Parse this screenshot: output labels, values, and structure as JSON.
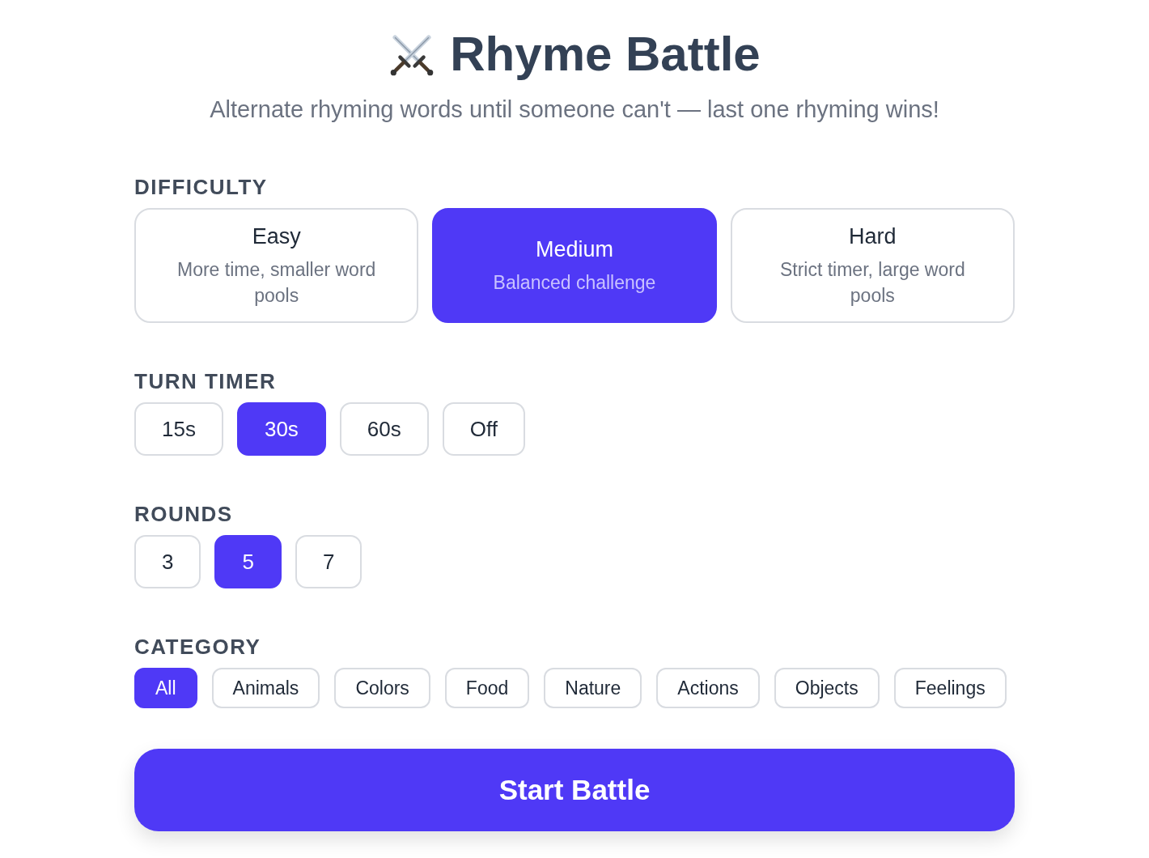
{
  "header": {
    "title": "Rhyme Battle",
    "subtitle": "Alternate rhyming words until someone can't — last one rhyming wins!"
  },
  "sections": [
    {
      "kind": "cards",
      "label": "DIFFICULTY",
      "options": [
        {
          "title": "Easy",
          "description": "More time, smaller word pools",
          "selected": false
        },
        {
          "title": "Medium",
          "description": "Balanced challenge",
          "selected": true
        },
        {
          "title": "Hard",
          "description": "Strict timer, large word pools",
          "selected": false
        }
      ]
    },
    {
      "kind": "buttons",
      "label": "TURN TIMER",
      "options": [
        {
          "label": "15s",
          "selected": false
        },
        {
          "label": "30s",
          "selected": true
        },
        {
          "label": "60s",
          "selected": false
        },
        {
          "label": "Off",
          "selected": false
        }
      ]
    },
    {
      "kind": "buttons",
      "label": "ROUNDS",
      "options": [
        {
          "label": "3",
          "selected": false
        },
        {
          "label": "5",
          "selected": true
        },
        {
          "label": "7",
          "selected": false
        }
      ]
    },
    {
      "kind": "chips",
      "label": "CATEGORY",
      "options": [
        {
          "label": "All",
          "selected": true
        },
        {
          "label": "Animals",
          "selected": false
        },
        {
          "label": "Colors",
          "selected": false
        },
        {
          "label": "Food",
          "selected": false
        },
        {
          "label": "Nature",
          "selected": false
        },
        {
          "label": "Actions",
          "selected": false
        },
        {
          "label": "Objects",
          "selected": false
        },
        {
          "label": "Feelings",
          "selected": false
        }
      ]
    }
  ],
  "start_button": {
    "label": "Start Battle"
  }
}
